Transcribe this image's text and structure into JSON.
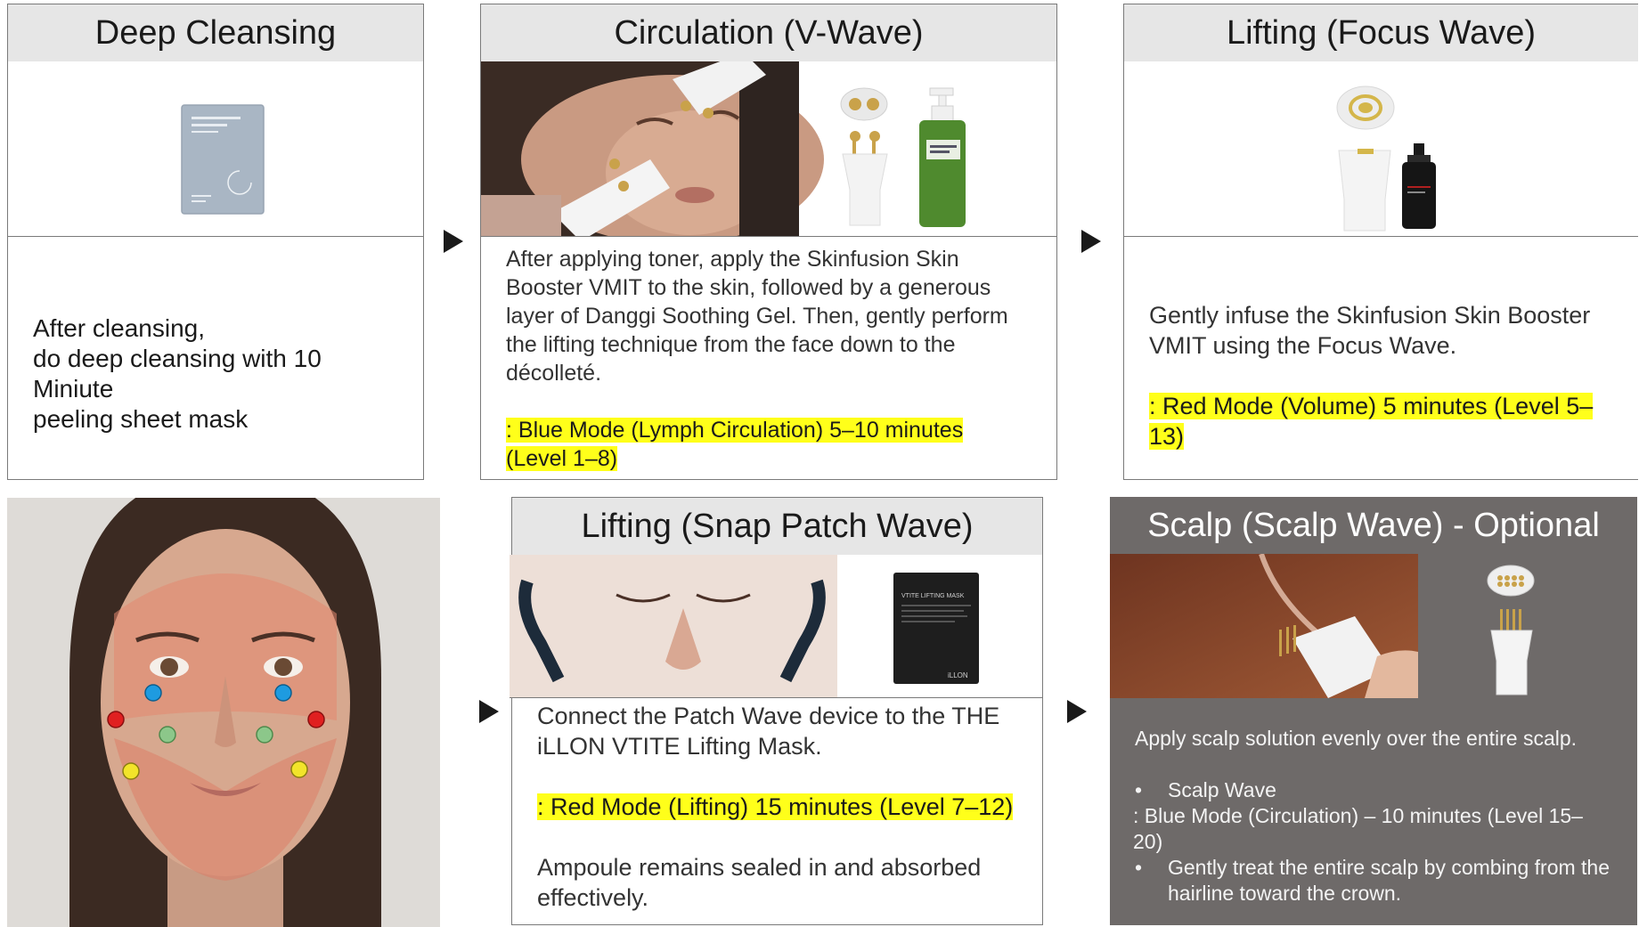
{
  "steps": {
    "deep_cleansing": {
      "title": "Deep Cleansing",
      "body": [
        "After cleansing,",
        "do deep cleansing with 10 Miniute",
        "peeling sheet mask"
      ]
    },
    "circulation": {
      "title": "Circulation (V-Wave)",
      "body": "After applying toner, apply the Skinfusion Skin Booster VMIT to the skin, followed by a generous layer of Danggi Soothing Gel. Then, gently perform the lifting technique from the face down to the décolleté.",
      "highlight_1": ": Blue Mode (Lymph Circulation) 5–10 minutes",
      "highlight_2": "(Level 1–8)"
    },
    "lifting_focus": {
      "title": "Lifting (Focus Wave)",
      "body": "Gently infuse the Skinfusion Skin Booster VMIT using the Focus Wave.",
      "highlight": ": Red Mode (Volume) 5 minutes (Level 5–13)"
    },
    "lifting_snap": {
      "title": "Lifting (Snap Patch Wave)",
      "body": "Connect the Patch Wave device to the THE iLLON VTITE Lifting Mask.",
      "highlight": ": Red Mode (Lifting) 15 minutes (Level 7–12)",
      "note": "Ampoule remains sealed in and absorbed effectively.",
      "mask_label": "VTITE LIFTING MASK",
      "brand": "iLLON"
    },
    "scalp": {
      "title": "Scalp (Scalp Wave) - Optional",
      "intro": "Apply scalp solution evenly over the entire scalp.",
      "bullet_1": "Scalp Wave",
      "mode_line": ": Blue Mode (Circulation) – 10 minutes (Level 15–20)",
      "bullet_2": "Gently treat the entire scalp by combing from the hairline toward the crown."
    }
  },
  "colors": {
    "header_bg": "#e6e6e6",
    "highlight": "#ffff1a",
    "dark_panel": "#6e6a69",
    "dot_blue": "#1e9be0",
    "dot_red": "#e02020",
    "dot_green": "#8cc78a",
    "dot_yellow": "#f2e42a"
  }
}
